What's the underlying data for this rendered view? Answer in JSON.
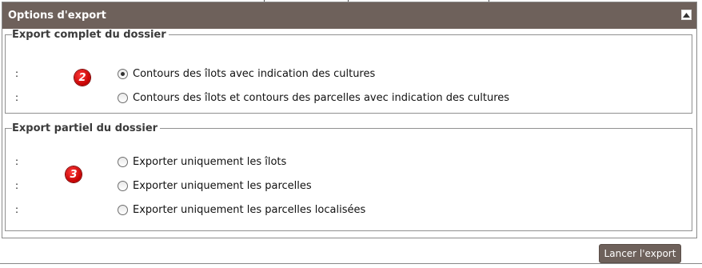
{
  "panel": {
    "title": "Options d'export",
    "collapse_icon": "chevron-up-icon"
  },
  "section_complete": {
    "legend": "Export complet du dossier",
    "badge": "2",
    "options": [
      {
        "colon": ":",
        "label": "Contours des îlots avec indication des cultures",
        "selected": true
      },
      {
        "colon": ":",
        "label": "Contours des îlots et contours des parcelles avec indication des cultures",
        "selected": false
      }
    ]
  },
  "section_partial": {
    "legend": "Export partiel du dossier",
    "badge": "3",
    "options": [
      {
        "colon": ":",
        "label": "Exporter uniquement les îlots",
        "selected": false
      },
      {
        "colon": ":",
        "label": "Exporter uniquement les parcelles",
        "selected": false
      },
      {
        "colon": ":",
        "label": "Exporter uniquement les parcelles localisées",
        "selected": false
      }
    ]
  },
  "actions": {
    "export_label": "Lancer l'export"
  },
  "colors": {
    "header_bg": "#6e615b",
    "badge_red": "#d40000"
  }
}
